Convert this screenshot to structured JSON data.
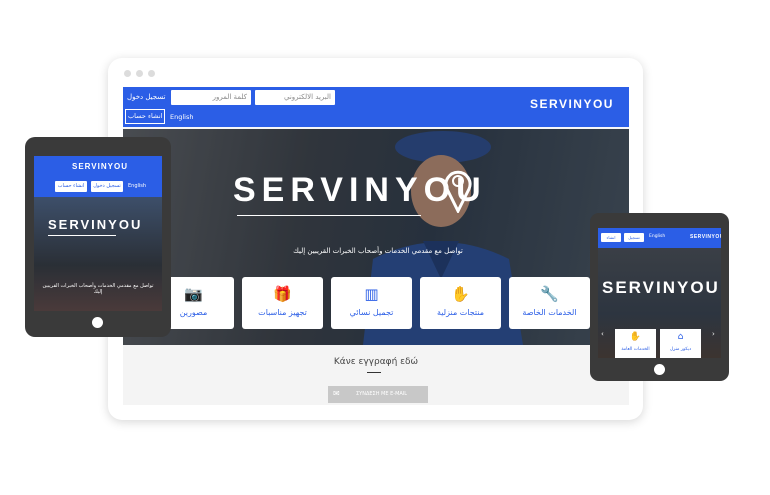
{
  "brand": {
    "name": "SERVINYOU",
    "accent": "#2b5ee6"
  },
  "desktop": {
    "nav": {
      "email_placeholder": "البريد الالكتروني",
      "password_placeholder": "كلمة المرور",
      "login_label": "تسجيل دخول",
      "register_label": "انشاء حساب",
      "language_label": "English"
    },
    "hero": {
      "tagline": "تواصل مع مقدمي الخدمات وأصحاب الخبرات القريبين إليك"
    },
    "cards": [
      {
        "label": "الخدمات الخاصة",
        "icon": "wrench-icon"
      },
      {
        "label": "منتجات منزلية",
        "icon": "hands-icon"
      },
      {
        "label": "تجميل نسائي",
        "icon": "comb-icon"
      },
      {
        "label": "تجهيز مناسبات",
        "icon": "gift-icon"
      },
      {
        "label": "مصورين",
        "icon": "camera-icon"
      }
    ],
    "signup": {
      "title": "Κάνε εγγραφή εδώ",
      "button_label": "ΣΥΝΔΕΣΗ ΜΕ E-MAIL"
    }
  },
  "tablet_left": {
    "language_label": "English",
    "login_label": "تسجيل دخول",
    "register_label": "انشاء حساب",
    "tagline": "تواصل مع مقدمي الخدمات وأصحاب الخبرات القريبين إليك"
  },
  "tablet_right": {
    "language_label": "English",
    "login_label": "تسجيل دخول",
    "register_label": "انشاء حساب",
    "cards": [
      {
        "label": "ديكور منزل",
        "icon": "home-icon"
      },
      {
        "label": "الخدمات العامة",
        "icon": "handshake-icon"
      }
    ]
  }
}
